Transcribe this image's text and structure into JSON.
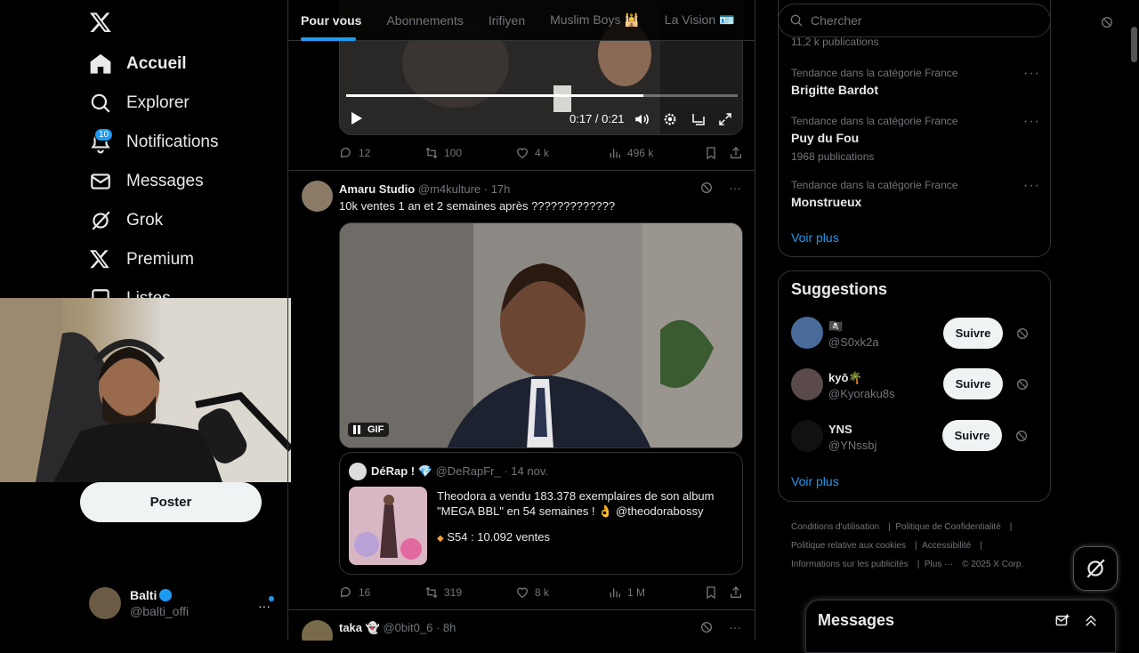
{
  "nav": {
    "items": [
      {
        "label": "Accueil",
        "icon": "home-icon"
      },
      {
        "label": "Explorer",
        "icon": "search-icon"
      },
      {
        "label": "Notifications",
        "icon": "bell-icon"
      },
      {
        "label": "Messages",
        "icon": "mail-icon"
      },
      {
        "label": "Grok",
        "icon": "grok-icon"
      },
      {
        "label": "Premium",
        "icon": "x-logo-icon"
      },
      {
        "label": "Listes",
        "icon": "list-icon"
      }
    ],
    "notification_count": "10",
    "post_label": "Poster"
  },
  "profile": {
    "name": "Balti",
    "handle": "@balti_offi"
  },
  "tabs": [
    "Pour vous",
    "Abonnements",
    "Irifiyen",
    "Muslim Boys 🕌",
    "La Vision 🪪"
  ],
  "video_player": {
    "time": "0:17 / 0:21",
    "progress": 0.76
  },
  "post1": {
    "replies": "12",
    "reposts": "100",
    "likes": "4 k",
    "views": "496 k"
  },
  "post2": {
    "author": "Amaru Studio",
    "handle": "@m4kulture",
    "time": "· 17h",
    "text": "10k ventes 1 an et 2 semaines après ?????????????",
    "gif_label": "GIF",
    "quote": {
      "author": "DéRap !",
      "handle": "@DeRapFr_",
      "time": "· 14 nov.",
      "text1": "Theodora a vendu 183.378 exemplaires de son album",
      "text2": "\"MEGA BBL\" en 54 semaines ! 👌 @theodorabossy",
      "text3": "S54 : 10.092 ventes"
    },
    "replies": "16",
    "reposts": "319",
    "likes": "8 k",
    "views": "1 M"
  },
  "post3": {
    "author": "taka",
    "handle": "@0bit0_6",
    "time": "· 8h"
  },
  "search": {
    "placeholder": "Chercher"
  },
  "trends": {
    "top_cut": "11,2 k publications",
    "items": [
      {
        "category": "Tendance dans la catégorie France",
        "name": "Brigitte Bardot",
        "count": ""
      },
      {
        "category": "Tendance dans la catégorie France",
        "name": "Puy du Fou",
        "count": "1968 publications"
      },
      {
        "category": "Tendance dans la catégorie France",
        "name": "Monstrueux",
        "count": ""
      }
    ],
    "see_more": "Voir plus"
  },
  "suggestions": {
    "title": "Suggestions",
    "items": [
      {
        "name": "🏴‍☠️",
        "handle": "@S0xk2a",
        "button": "Suivre"
      },
      {
        "name": "kyō🌴",
        "handle": "@Kyoraku8s",
        "button": "Suivre"
      },
      {
        "name": "YNS",
        "handle": "@YNssbj",
        "button": "Suivre"
      }
    ],
    "see_more": "Voir plus"
  },
  "footer": {
    "line1a": "Conditions d'utilisation",
    "line1b": "Politique de Confidentialité",
    "line2a": "Politique relative aux cookies",
    "line2b": "Accessibilité",
    "line3a": "Informations sur les publicités",
    "line3b": "Plus ···",
    "line3c": "© 2025 X Corp."
  },
  "messages_bar": {
    "title": "Messages"
  },
  "colors": {
    "accent": "#1d9bf0",
    "background": "#000000",
    "border": "#2f3336",
    "muted": "#71767b"
  }
}
